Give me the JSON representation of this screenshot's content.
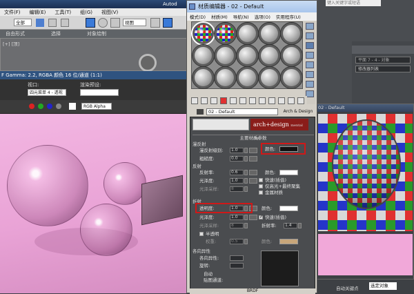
{
  "max": {
    "title_partial": "Autod",
    "menu": [
      "文件(F)",
      "编辑(E)",
      "工具(T)",
      "组(G)",
      "视图(V)"
    ],
    "toolbar": {
      "select_filter": "全部",
      "view_dropdown": "视图"
    },
    "ribbon_tabs": [
      "自由形式",
      "选择",
      "对象绘制"
    ],
    "viewport_label": "[+] [顶]",
    "search_placeholder": "键入关键字或短语"
  },
  "vfb": {
    "title": "F Gamma: 2.2, RGBA 颜色 16 位/通道 (1:1)",
    "viewport_label": "视口:",
    "viewport_value": "四元菜单 4 - 透视",
    "preset_label": "渲染预设:",
    "preset_value": "",
    "channel_value": "RGB Alpha"
  },
  "mat": {
    "title": "材质编辑器 - 02 - Default",
    "menu": [
      "模式(D)",
      "材质(M)",
      "导航(N)",
      "选项(O)",
      "实用程序(U)"
    ],
    "name": "02 - Default",
    "type": "Arch & Design",
    "logo": "arch+design",
    "logo_sub": "mental ray",
    "rollout_title": "主要材质参数",
    "diffuse": {
      "head": "漫反射",
      "level_label": "漫反射级别:",
      "level": "1.0",
      "rough_label": "粗糙度:",
      "rough": "0.0",
      "color_label": "颜色:",
      "color": "#111111"
    },
    "reflection": {
      "head": "反射",
      "refl_label": "反射率:",
      "refl": "0.6",
      "gloss_label": "光泽度:",
      "gloss": "1.0",
      "samples_label": "光泽采样:",
      "samples": "8",
      "color_label": "颜色:",
      "color": "#ffffff",
      "opt1": "快速(插值)",
      "opt2": "仅高光+最终聚集",
      "opt3": "金属材质"
    },
    "refraction": {
      "head": "折射",
      "trans_label": "透明度:",
      "trans": "1.0",
      "gloss_label": "光泽度:",
      "gloss": "1.0",
      "samples_label": "光泽采样:",
      "samples": "8",
      "color_label": "颜色:",
      "color": "#ffffff",
      "opt1": "快速(插值)",
      "ior_label": "折射率:",
      "ior": "1.4"
    },
    "translucency": {
      "label": "半透明",
      "weight_label": "权重:",
      "weight": "0.5",
      "color_label": "颜色:",
      "color": "#c8a67a"
    },
    "aniso": {
      "head": "各向异性",
      "aniso_label": "各向异性:",
      "rotation_label": "旋转:",
      "opt_auto": "自动",
      "opt_map": "贴图通道:"
    },
    "bottom": "BRDF"
  },
  "preview": {
    "title": "02 - Default"
  },
  "cmd": {
    "objname": "平面 7 - 4 - 对象",
    "modlist": "修改器列表"
  },
  "statusbar": {
    "autokey": "自动关键点",
    "selected": "选定对象"
  }
}
